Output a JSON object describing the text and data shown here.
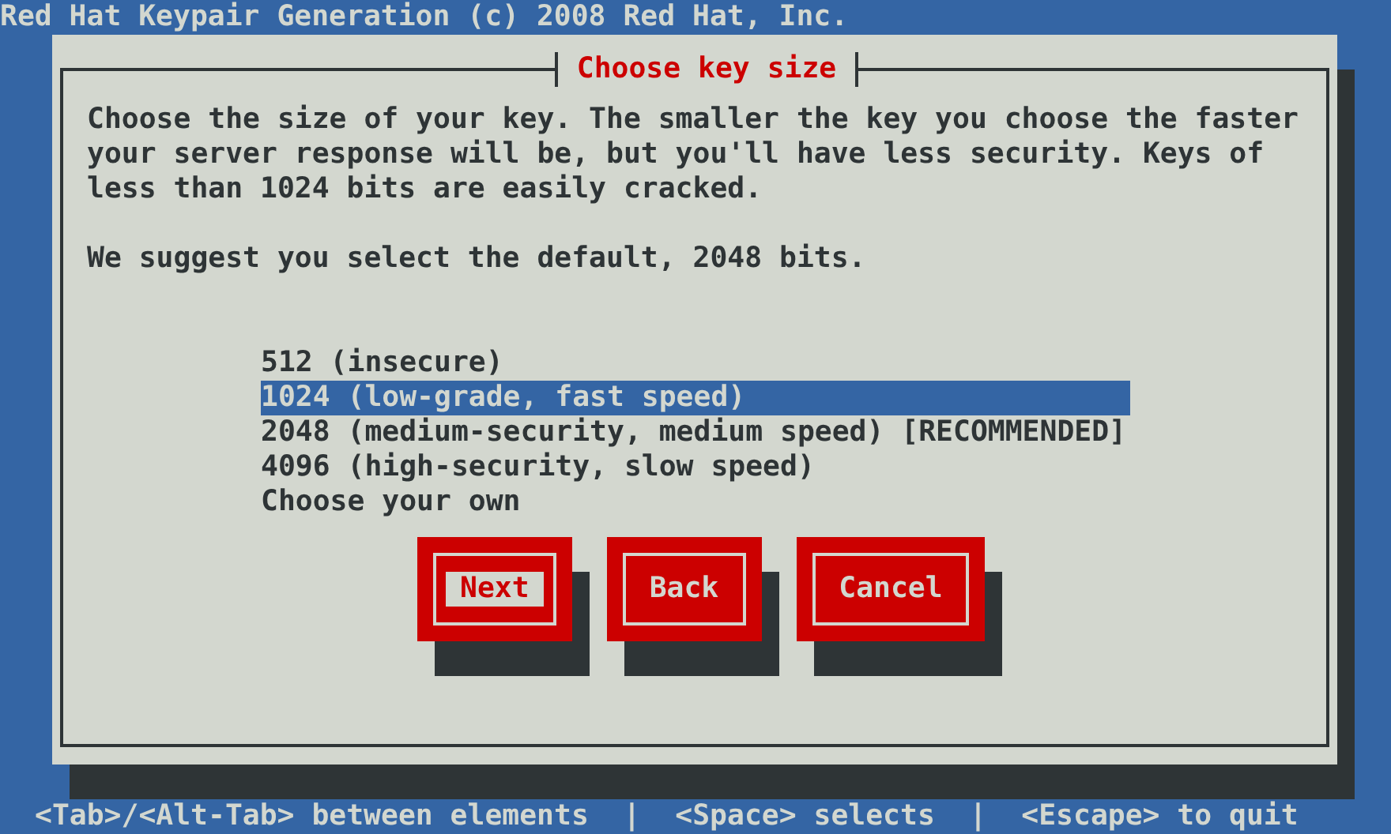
{
  "screen_title": "Red Hat Keypair Generation (c) 2008 Red Hat, Inc.",
  "dialog": {
    "title": "Choose key size",
    "description": "Choose the size of your key. The smaller the key you choose the faster your server response will be, but you'll have less security. Keys of less than 1024 bits are easily cracked.",
    "suggestion": "We suggest you select the default, 2048 bits.",
    "options": [
      {
        "label": "512 (insecure)",
        "selected": false
      },
      {
        "label": "1024 (low-grade, fast speed)",
        "selected": true
      },
      {
        "label": "2048 (medium-security, medium speed) [RECOMMENDED]",
        "selected": false
      },
      {
        "label": "4096 (high-security, slow speed)",
        "selected": false
      },
      {
        "label": "Choose your own",
        "selected": false
      }
    ],
    "buttons": [
      {
        "label": "Next",
        "focused": true
      },
      {
        "label": "Back",
        "focused": false
      },
      {
        "label": "Cancel",
        "focused": false
      }
    ]
  },
  "status_bar": "<Tab>/<Alt-Tab> between elements  |  <Space> selects  |  <Escape> to quit"
}
